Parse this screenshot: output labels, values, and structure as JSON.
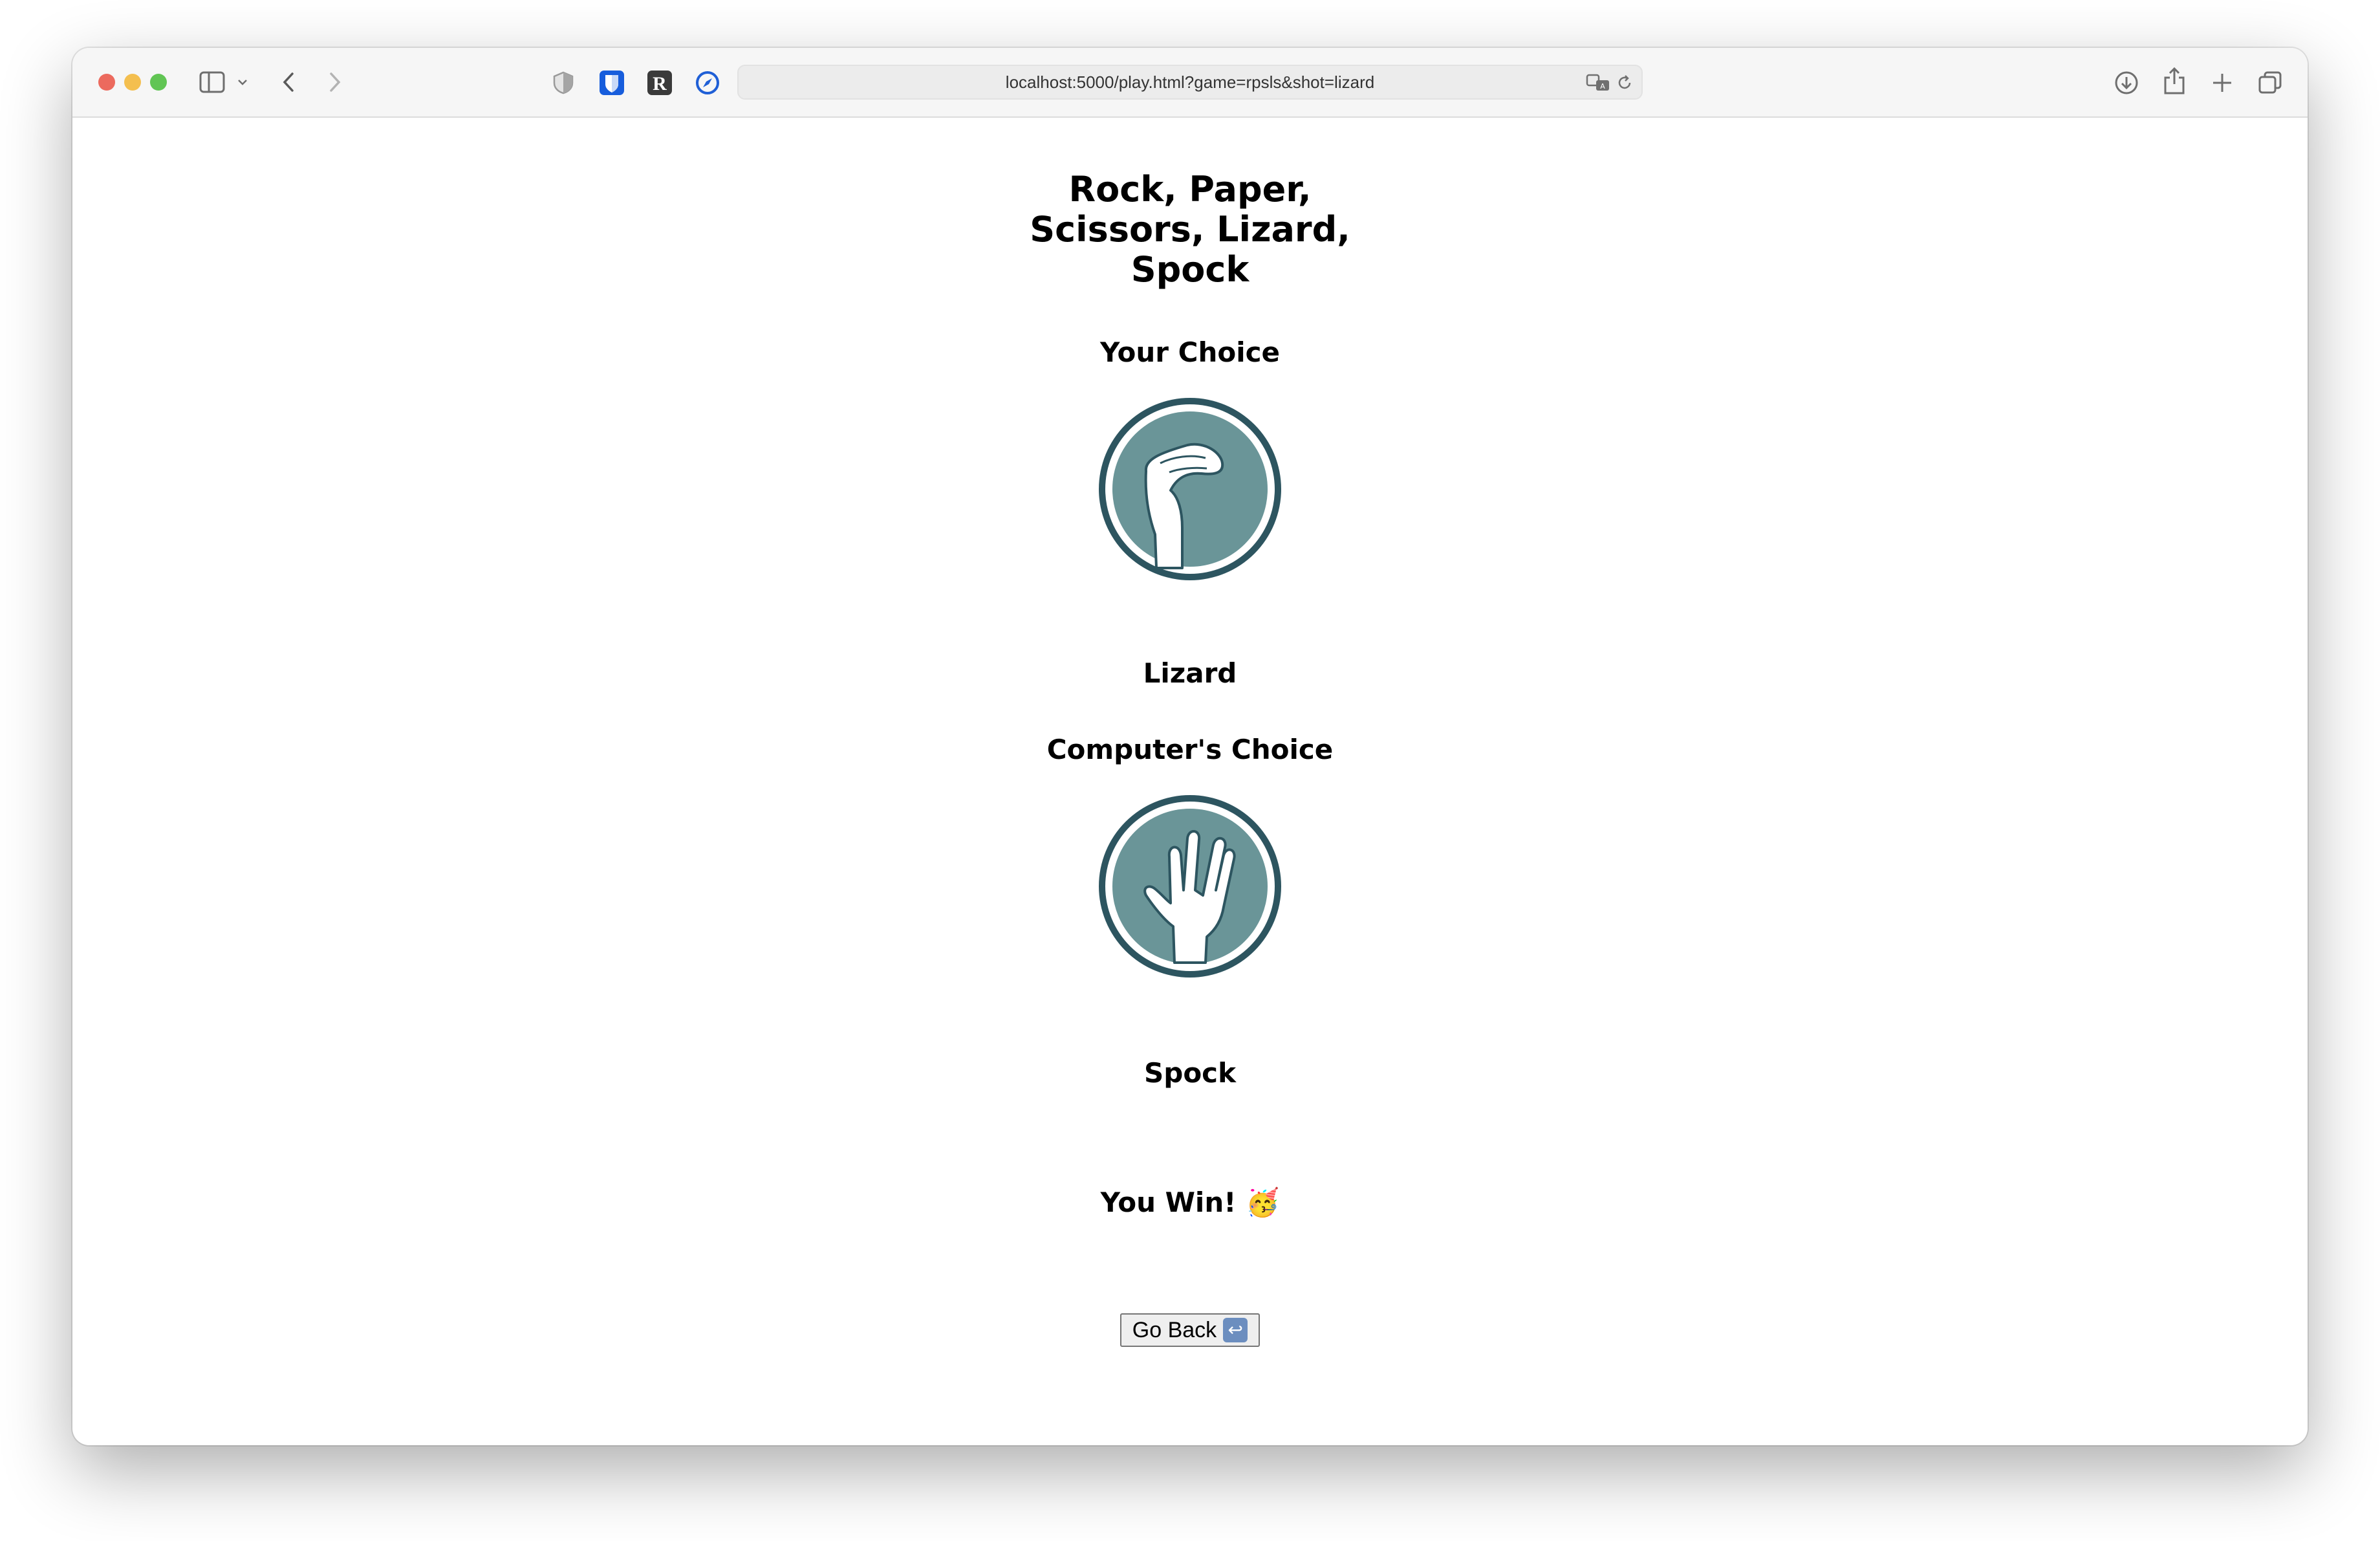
{
  "browser": {
    "url": "localhost:5000/play.html?game=rpsls&shot=lizard"
  },
  "page": {
    "title": "Rock, Paper, Scissors, Lizard, Spock",
    "your_choice_heading": "Your Choice",
    "your_choice_label": "Lizard",
    "computer_choice_heading": "Computer's Choice",
    "computer_choice_label": "Spock",
    "result_text": "You Win!",
    "result_emoji": "🥳",
    "back_button_label": "Go Back",
    "back_button_emoji": "↩"
  },
  "colors": {
    "icon_ring": "#2d5560",
    "icon_fill": "#6a9598",
    "traffic_red": "#ec6a5e",
    "traffic_yellow": "#f4bf4f",
    "traffic_green": "#61c554"
  },
  "icons": {
    "your_choice": "lizard-hand-icon",
    "computer_choice": "spock-hand-icon"
  }
}
